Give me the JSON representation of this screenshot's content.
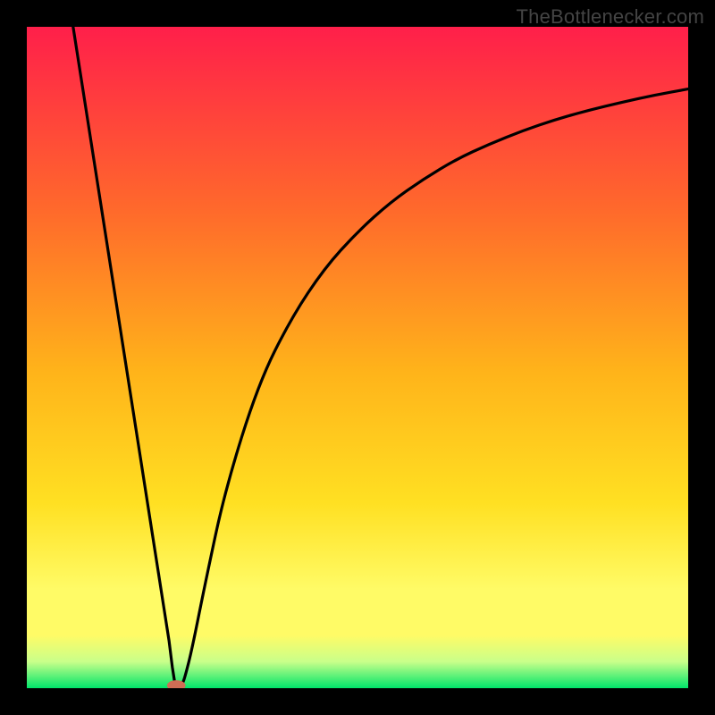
{
  "watermark": "TheBottlenecker.com",
  "colors": {
    "top": "#ff1f4a",
    "mid_upper": "#ff6a2b",
    "mid": "#ffb31a",
    "mid_lower": "#ffe022",
    "yellow_band": "#fffb66",
    "pale": "#c9ff8a",
    "green": "#00e56a",
    "curve": "#000000",
    "marker": "#cf6d55"
  },
  "chart_data": {
    "type": "line",
    "title": "",
    "xlabel": "",
    "ylabel": "",
    "xlim": [
      0,
      100
    ],
    "ylim": [
      0,
      100
    ],
    "series": [
      {
        "name": "curve",
        "x": [
          7,
          10,
          13,
          16,
          19,
          21.5,
          22,
          22.5,
          23.5,
          24,
          25,
          27,
          30,
          35,
          40,
          45,
          50,
          55,
          60,
          65,
          70,
          75,
          80,
          85,
          90,
          95,
          100
        ],
        "y": [
          100,
          80.8,
          61.6,
          42.4,
          23.2,
          7.2,
          3.2,
          0,
          0.5,
          2,
          6,
          16,
          30,
          46,
          56,
          63.5,
          69,
          73.5,
          77,
          80,
          82.3,
          84.3,
          86,
          87.4,
          88.6,
          89.7,
          90.6
        ]
      }
    ],
    "marker": {
      "x": 22.6,
      "y": 0.4,
      "rx": 1.4,
      "ry": 0.8
    }
  }
}
